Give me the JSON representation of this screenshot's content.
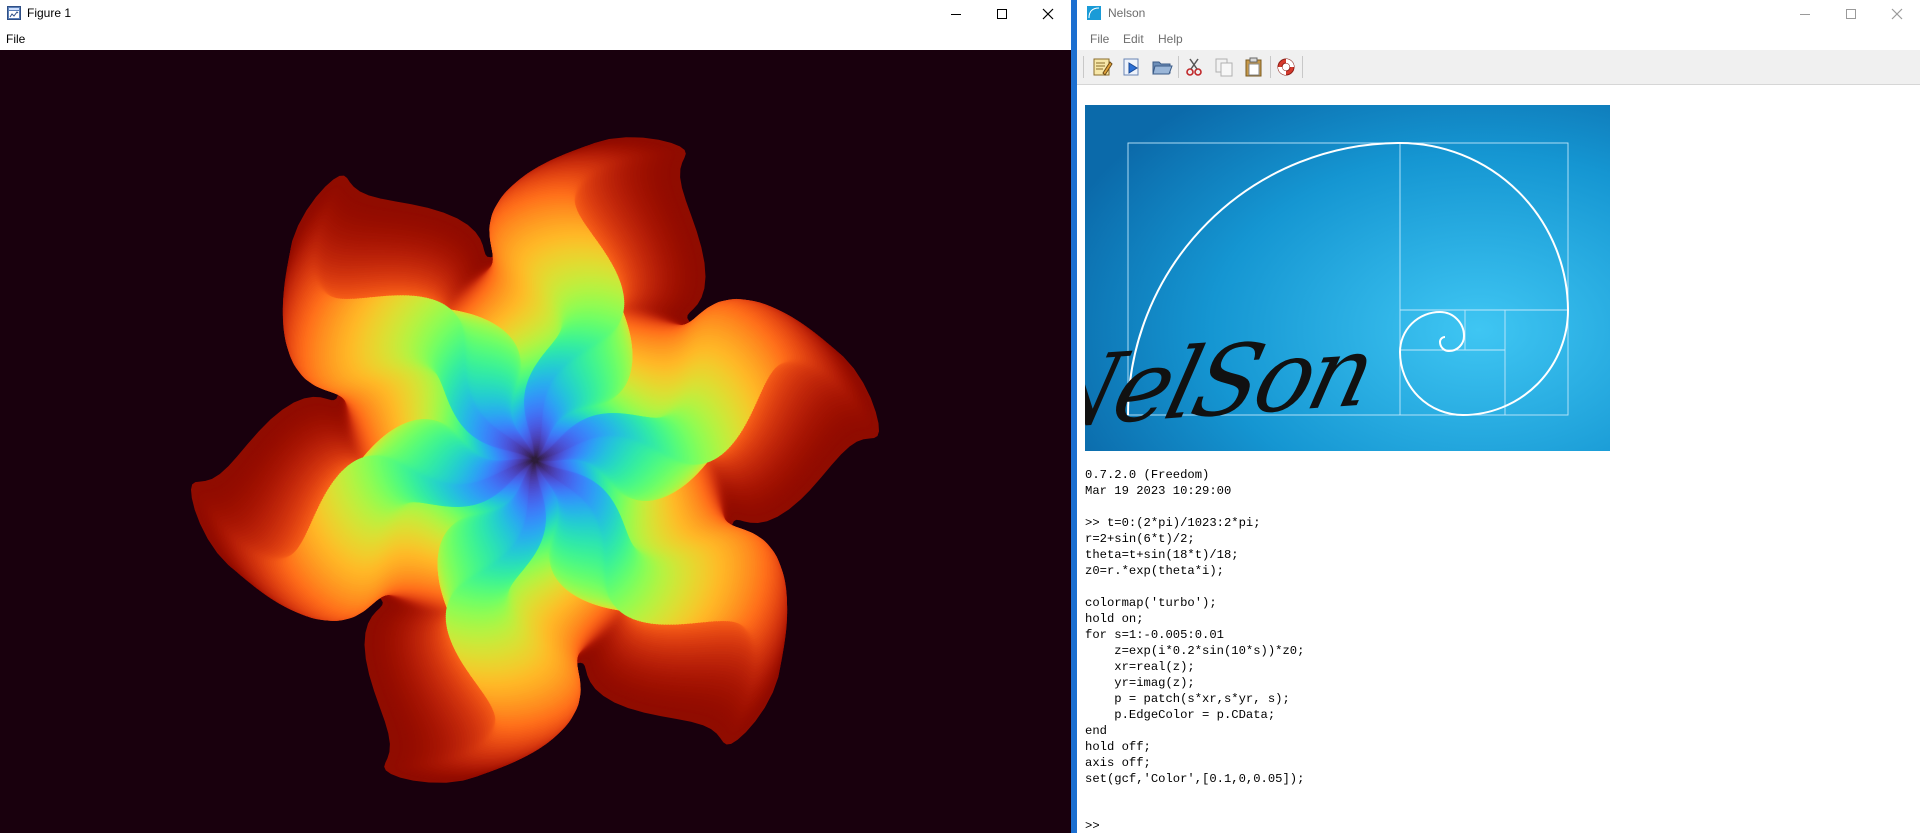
{
  "figure_window": {
    "title": "Figure 1",
    "menu": [
      "File"
    ],
    "background_color": "#19000d",
    "icons": [
      "figure-app-icon",
      "minimize-icon",
      "maximize-icon",
      "close-icon"
    ]
  },
  "nelson_window": {
    "title": "Nelson",
    "menu": [
      "File",
      "Edit",
      "Help"
    ],
    "toolbar_icons": [
      "editor-icon",
      "run-icon",
      "open-folder-icon",
      "cut-icon",
      "copy-icon",
      "paste-icon",
      "help-lifebuoy-icon"
    ],
    "banner_text": "NelSon",
    "accent_color": "#1c6fd0"
  },
  "console": {
    "lines": [
      "0.7.2.0 (Freedom)",
      "Mar 19 2023 10:29:00",
      "",
      ">> t=0:(2*pi)/1023:2*pi;",
      "r=2+sin(6*t)/2;",
      "theta=t+sin(18*t)/18;",
      "z0=r.*exp(theta*i);",
      "",
      "colormap('turbo');",
      "hold on;",
      "for s=1:-0.005:0.01",
      "    z=exp(i*0.2*sin(10*s))*z0;",
      "    xr=real(z);",
      "    yr=imag(z);",
      "    p = patch(s*xr,s*yr, s);",
      "    p.EdgeColor = p.CData;",
      "end",
      "hold off;",
      "axis off;",
      "set(gcf,'Color',[0.1,0,0.05]);"
    ],
    "prompt": ">>"
  }
}
